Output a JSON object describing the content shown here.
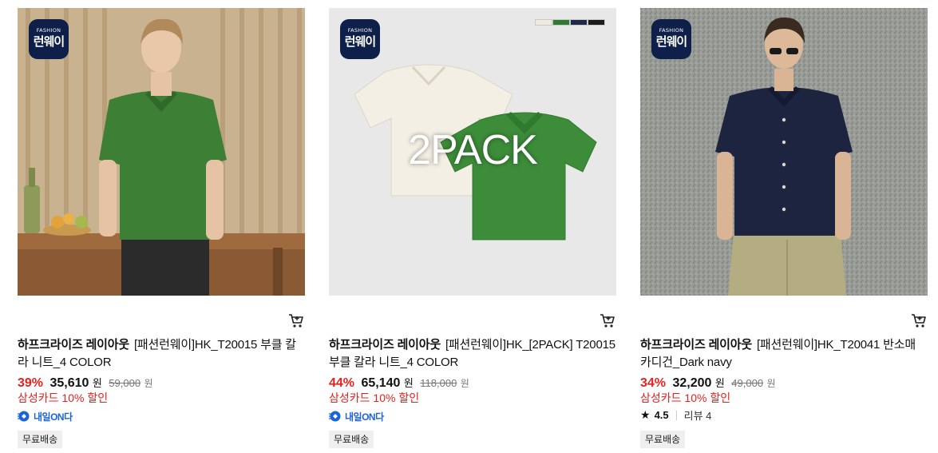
{
  "products": [
    {
      "badge_top": "FASHION",
      "badge_main": "런웨이",
      "brand": "하프크라이즈 레이아웃",
      "name": "[패션런웨이]HK_T20015 부클 칼라 니트_4 COLOR",
      "discount": "39%",
      "price": "35,610",
      "price_unit": "원",
      "original_price": "59,000",
      "original_unit": "원",
      "card_promo": "삼성카드 10% 할인",
      "delivery_label": "내일ON다",
      "shipping_tag": "무료배송"
    },
    {
      "badge_top": "FASHION",
      "badge_main": "런웨이",
      "overlay_text": "2PACK",
      "swatch_colors": [
        "#efeade",
        "#2f7a33",
        "#1f2a4a",
        "#1c1c1c"
      ],
      "brand": "하프크라이즈 레이아웃",
      "name": "[패션런웨이]HK_[2PACK] T20015 부클 칼라 니트_4 COLOR",
      "discount": "44%",
      "price": "65,140",
      "price_unit": "원",
      "original_price": "118,000",
      "original_unit": "원",
      "card_promo": "삼성카드 10% 할인",
      "delivery_label": "내일ON다",
      "shipping_tag": "무료배송"
    },
    {
      "badge_top": "FASHION",
      "badge_main": "런웨이",
      "brand": "하프크라이즈 레이아웃",
      "name": "[패션런웨이]HK_T20041 반소매 카디건_Dark navy",
      "discount": "34%",
      "price": "32,200",
      "price_unit": "원",
      "original_price": "49,000",
      "original_unit": "원",
      "card_promo": "삼성카드 10% 할인",
      "rating": "4.5",
      "review_label": "리뷰 4",
      "shipping_tag": "무료배송"
    }
  ],
  "colors": {
    "discount_red": "#e8211e",
    "delivery_blue": "#1a63d9",
    "badge_navy": "#0e1f4a"
  }
}
